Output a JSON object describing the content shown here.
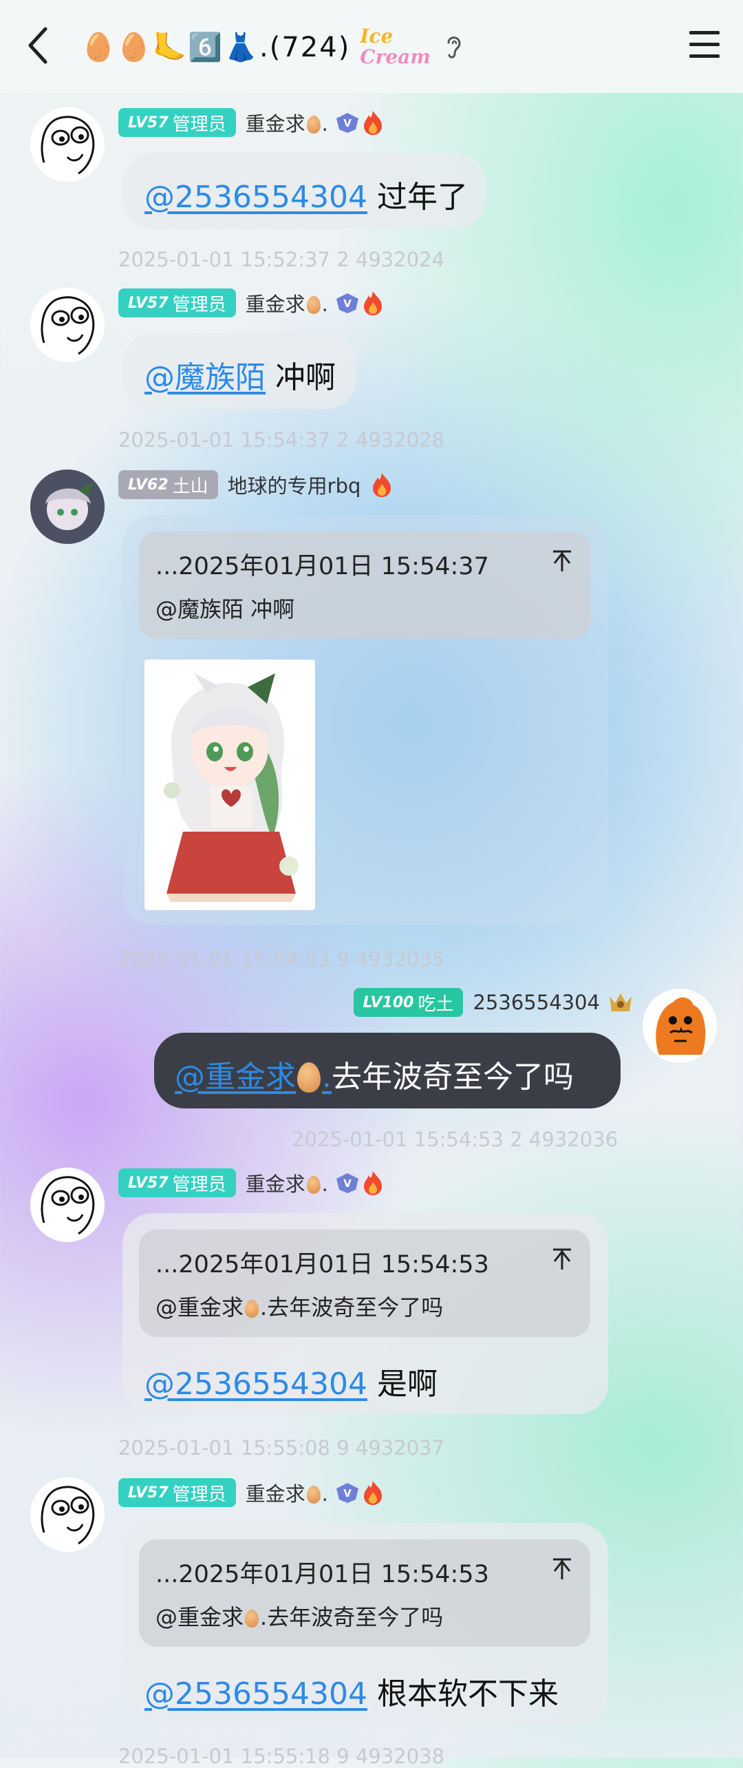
{
  "header": {
    "title": "🥚🥚🦶6️⃣👗.(724)",
    "brand_top": "Ice",
    "brand_bottom": "Cream"
  },
  "messages": [
    {
      "level": "LV57",
      "role": "管理员",
      "sender": "重金求",
      "sender_suffix": ".",
      "mention": "@2536554304",
      "text": "过年了",
      "timestamp": "2025-01-01 15:52:37 2 4932024"
    },
    {
      "level": "LV57",
      "role": "管理员",
      "sender": "重金求",
      "sender_suffix": ".",
      "mention": "@魔族陌",
      "text": "冲啊",
      "timestamp": "2025-01-01 15:54:37 2 4932028"
    },
    {
      "level": "LV62",
      "role": "土山",
      "sender": "地球的专用rbq",
      "quote_head": "...2025年01月01日 15:54:37",
      "quote_body": "@魔族陌 冲啊",
      "timestamp": "2025-01-01 15:54:53 9 4932035"
    },
    {
      "level": "LV100",
      "role": "吃土",
      "sender": "2536554304",
      "mention": "@重金求",
      "mention_suffix": ".",
      "text": "去年波奇至今了吗",
      "timestamp": "2025-01-01 15:54:53 2 4932036"
    },
    {
      "level": "LV57",
      "role": "管理员",
      "sender": "重金求",
      "sender_suffix": ".",
      "quote_head": "...2025年01月01日 15:54:53",
      "quote_body_pre": "@重金求",
      "quote_body_post": ".去年波奇至今了吗",
      "mention": "@2536554304",
      "text": "是啊",
      "timestamp": "2025-01-01 15:55:08 9 4932037"
    },
    {
      "level": "LV57",
      "role": "管理员",
      "sender": "重金求",
      "sender_suffix": ".",
      "quote_head": "...2025年01月01日 15:54:53",
      "quote_body_pre": "@重金求",
      "quote_body_post": ".去年波奇至今了吗",
      "mention": "@2536554304",
      "text": "根本软不下来",
      "timestamp": "2025-01-01 15:55:18 9 4932038"
    }
  ],
  "colors": {
    "mention": "#2d8ae6",
    "admin_badge": "#34d1c2",
    "my_bubble": "#3b3e46"
  }
}
